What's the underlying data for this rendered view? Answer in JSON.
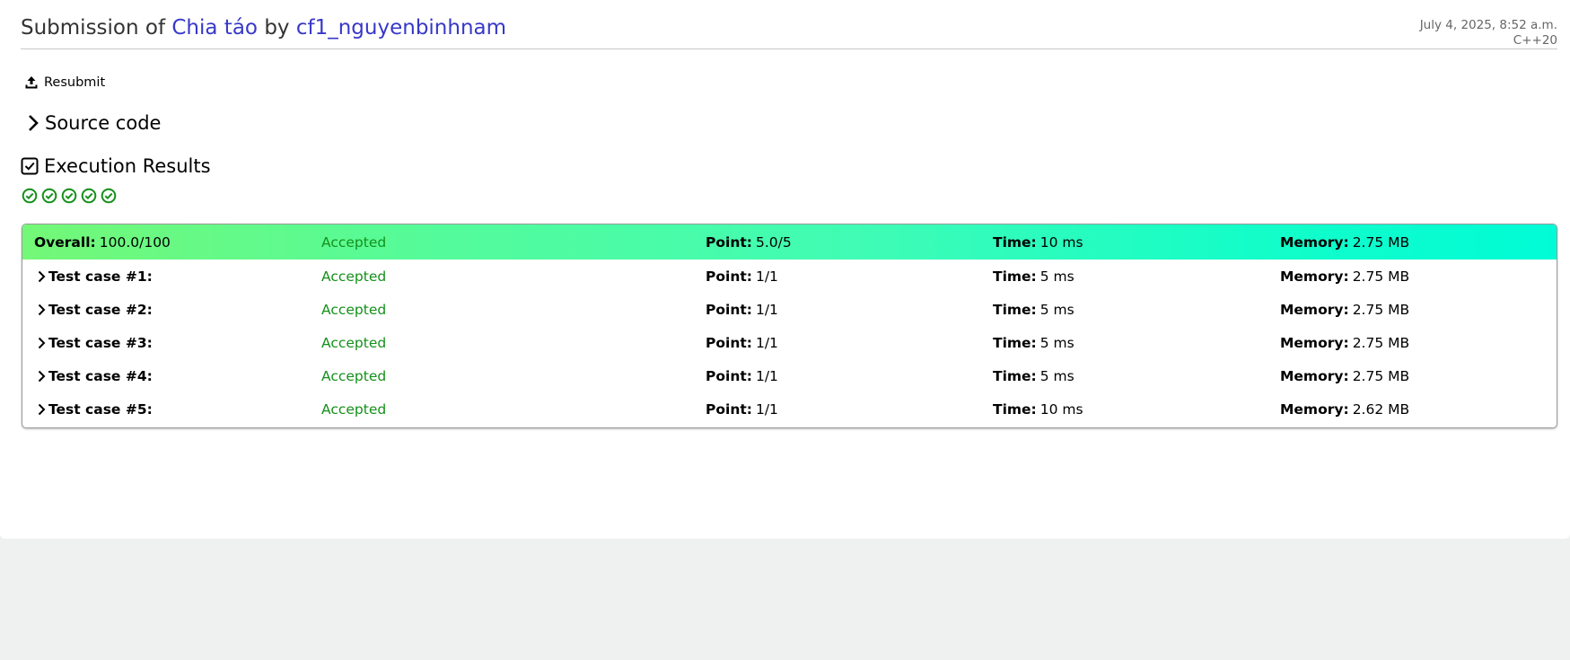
{
  "header": {
    "prefix": "Submission of",
    "problem": "Chia táo",
    "by": "by",
    "user": "cf1_nguyenbinhnam",
    "date": "July 4, 2025, 8:52 a.m.",
    "language": "C++20"
  },
  "actions": {
    "resubmit_label": "Resubmit",
    "source_label": "Source code"
  },
  "execution": {
    "title": "Execution Results",
    "check_icons": 5
  },
  "labels": {
    "overall": "Overall:",
    "point": "Point:",
    "time": "Time:",
    "memory": "Memory:"
  },
  "overall": {
    "score": "100.0/100",
    "status": "Accepted",
    "point": "5.0/5",
    "time": "10 ms",
    "memory": "2.75 MB"
  },
  "cases": [
    {
      "name": "Test case #1:",
      "status": "Accepted",
      "point": "1/1",
      "time": "5 ms",
      "memory": "2.75 MB"
    },
    {
      "name": "Test case #2:",
      "status": "Accepted",
      "point": "1/1",
      "time": "5 ms",
      "memory": "2.75 MB"
    },
    {
      "name": "Test case #3:",
      "status": "Accepted",
      "point": "1/1",
      "time": "5 ms",
      "memory": "2.75 MB"
    },
    {
      "name": "Test case #4:",
      "status": "Accepted",
      "point": "1/1",
      "time": "5 ms",
      "memory": "2.75 MB"
    },
    {
      "name": "Test case #5:",
      "status": "Accepted",
      "point": "1/1",
      "time": "10 ms",
      "memory": "2.62 MB"
    }
  ],
  "colors": {
    "link": "#3838c8",
    "accepted": "#14901a",
    "overall_gradient_start": "#74f877",
    "overall_gradient_end": "#00fcd6",
    "page_background": "#eff1f0"
  }
}
